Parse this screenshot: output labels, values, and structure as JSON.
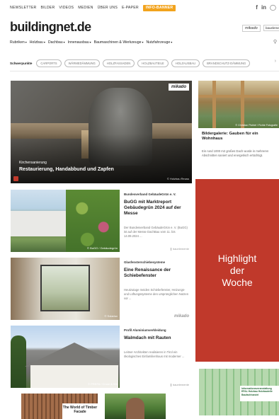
{
  "topnav": {
    "links": [
      "Newsletter",
      "Bilder",
      "Videos",
      "Medien",
      "Über uns",
      "E-Paper"
    ],
    "promo": "Info-Banner",
    "social": [
      "f",
      "in"
    ]
  },
  "header": {
    "logo": "buildingnet.de",
    "logo_accent": "",
    "brands": [
      "mikado",
      "bauelemente"
    ]
  },
  "nav": {
    "items": [
      "Rubriken",
      "Holzbau",
      "Dachbau",
      "Innenausbau",
      "Baumaschinen & Werkzeuge",
      "Nutzfahrzeuge"
    ]
  },
  "tags": {
    "label": "Schwerpunkte",
    "items": [
      "Carports",
      "Wärmedämmung",
      "Holzfassaden",
      "Holzbauteile",
      "Holzausbau",
      "Brandschutz-Dämmung"
    ]
  },
  "hero": {
    "kicker": "Kirchensanierung",
    "title": "Restaurierung, Handabbund und Zapfen",
    "credit": "© Holzbau Reuss",
    "brand": "mikado"
  },
  "right_card": {
    "title": "Bildergalerie: Gauben für ein Wohnhaus",
    "text": "Ein rund 1000 m2 großes Dach wurde in mehreren Abschnitten saniert und energetisch ertüchtigt.",
    "credit": "© Christian Pichtel / Fichte Fotografie"
  },
  "highlight": {
    "text": "Highlight\nder\nWoche",
    "color": "#c0392b"
  },
  "articles": [
    {
      "kicker": "Bundesverband GebäudeGrün e. V.",
      "title": "BuGG mit Marktreport Gebäudegrün 2024 auf der Messe",
      "text": "Der Bundesverband GebäudeGrün e. V. (BuGG) ist auf der Messe DachBau vom 11. bis 14.09.2024 ...",
      "credit": "© BuGG / Gebäudegrün",
      "publisher": "bauelemente"
    },
    {
      "kicker": "Glasfensterschiebesysteme",
      "title": "Eine Renaissance der Schiebefenster",
      "text": "Heutzutage meiden Schiebefenster, Heizungs- und Lüftungssysteme den ursprünglichen Nutzen vor ...",
      "credit": "© Solarlux",
      "publisher": "mikado"
    },
    {
      "kicker": "Profil Aluminiumverkleidung",
      "title": "Walmdach mit Rauten",
      "text": "Leitner Architekten realisieren in Tirol ein ökologisches Einfamilienhaus mit moderner ...",
      "credit": "© PREFA / Croce & Wir",
      "publisher": "bauelemente"
    }
  ],
  "bottom": {
    "left_title": "The World of Timber Facade",
    "right_text": "Informationsveranstaltung EPAL Holzbau Holzbauteile Baufachhandel"
  }
}
